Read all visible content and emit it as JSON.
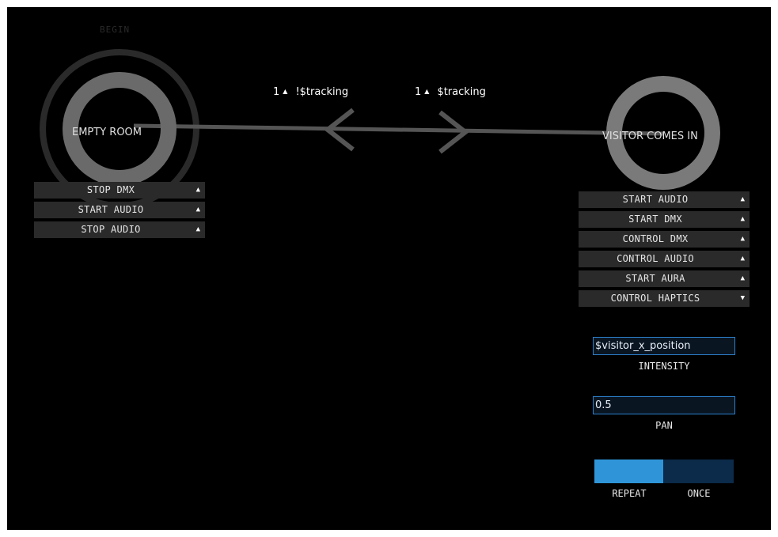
{
  "begin_label": "BEGIN",
  "states": {
    "empty_room": {
      "title": "EMPTY ROOM",
      "actions": [
        {
          "label": "STOP DMX",
          "caret": "▲"
        },
        {
          "label": "START AUDIO",
          "caret": "▲"
        },
        {
          "label": "STOP AUDIO",
          "caret": "▲"
        }
      ]
    },
    "visitor": {
      "title": "VISITOR COMES IN",
      "actions": [
        {
          "label": "START AUDIO",
          "caret": "▲"
        },
        {
          "label": "START DMX",
          "caret": "▲"
        },
        {
          "label": "CONTROL DMX",
          "caret": "▲"
        },
        {
          "label": "CONTROL AUDIO",
          "caret": "▲"
        },
        {
          "label": "START AURA",
          "caret": "▲"
        },
        {
          "label": "CONTROL HAPTICS",
          "caret": "▼"
        }
      ],
      "haptics": {
        "intensity_value": "$visitor_x_position",
        "intensity_label": "INTENSITY",
        "pan_value": "0.5",
        "pan_label": "PAN",
        "mode_options": [
          "REPEAT",
          "ONCE"
        ],
        "mode_selected": "REPEAT"
      }
    }
  },
  "transitions": [
    {
      "count": "1",
      "caret": "▲",
      "condition": "!$tracking"
    },
    {
      "count": "1",
      "caret": "▲",
      "condition": "$tracking"
    }
  ],
  "colors": {
    "background": "#000000",
    "ring": "#666666",
    "accent": "#2f95d8",
    "toggle_off": "#0c2a4a"
  }
}
